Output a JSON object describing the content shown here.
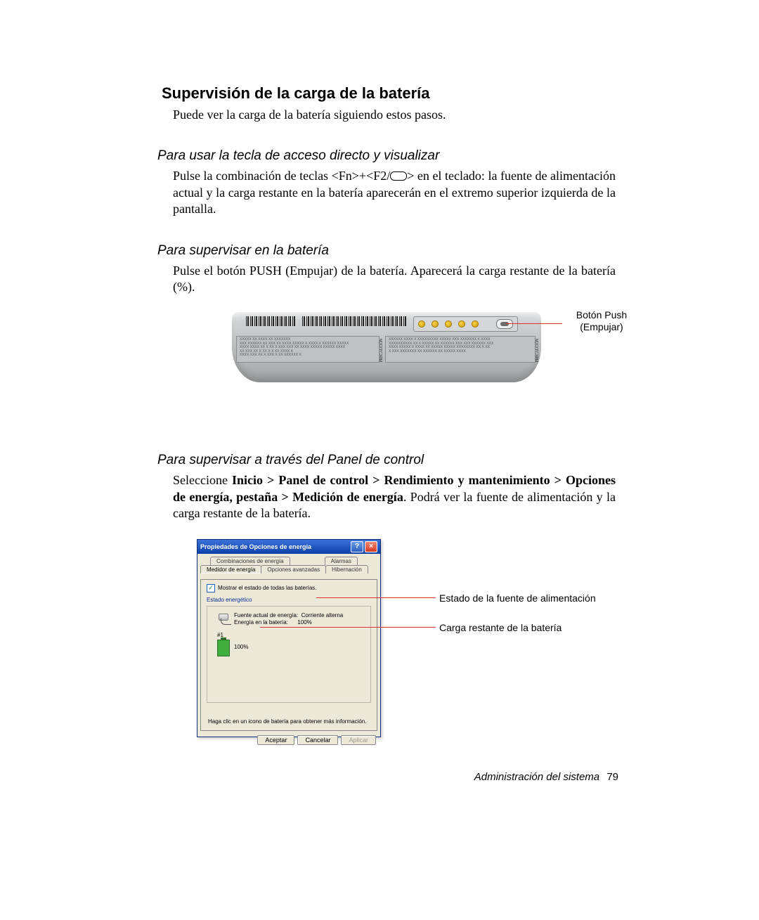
{
  "heading": "Supervisión de la carga de la batería",
  "intro": "Puede ver la carga de la batería siguiendo estos pasos.",
  "sections": {
    "hotkey": {
      "title": "Para usar la tecla de acceso directo y visualizar",
      "text_a": "Pulse la combinación de teclas <Fn>+<F2/",
      "text_b": "> en el teclado: la fuente de alimentación actual y la carga restante en la batería aparecerán en el extremo superior izquierda de la pantalla."
    },
    "battery": {
      "title": "Para supervisar en la batería",
      "text": "Pulse el botón PUSH (Empujar) de la batería. Aparecerá la carga restante de la batería (%)."
    },
    "panel": {
      "title": "Para supervisar a través del Panel de control",
      "pre": "Seleccione ",
      "bold": "Inicio > Panel de control > Rendimiento y mantenimiento > Opciones de energía, pestaña > Medición de energía",
      "post": ". Podrá ver la fuente de alimentación y la carga restante de la batería."
    }
  },
  "battery_callout": {
    "line1": "Botón Push",
    "line2": "(Empujar)"
  },
  "battery_warn_left": "PRECAUCIÓN",
  "battery_warn_right": "PRECAUCIÓN",
  "dialog": {
    "title": "Propiedades de Opciones de energía",
    "help": "?",
    "close": "×",
    "tabs_back": [
      "Combinaciones de energía",
      "Alarmas"
    ],
    "tabs_front": [
      "Medidor de energía",
      "Opciones avanzadas",
      "Hibernación"
    ],
    "checkbox": "Mostrar el estado de todas las baterías.",
    "fieldset_label": "Estado energético",
    "source_label": "Fuente actual de energía:",
    "source_value": "Corriente alterna",
    "battery_label": "Energía en la batería:",
    "battery_value": "100%",
    "slot_label": "#1",
    "slot_value": "100%",
    "hint": "Haga clic en un icono de batería para obtener más información.",
    "buttons": {
      "ok": "Aceptar",
      "cancel": "Cancelar",
      "apply": "Aplicar"
    }
  },
  "dialog_callouts": {
    "source": "Estado de la fuente de alimentación",
    "remaining": "Carga restante de la batería"
  },
  "footer": {
    "section": "Administración del sistema",
    "page": "79"
  }
}
